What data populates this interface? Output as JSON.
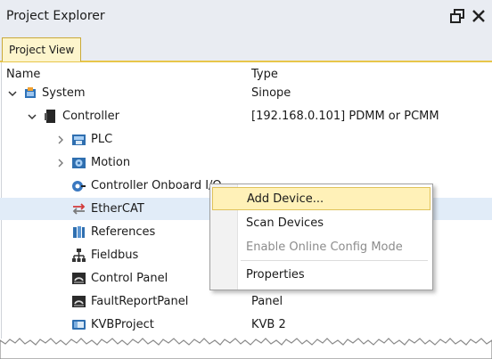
{
  "window": {
    "title": "Project Explorer"
  },
  "tabs": [
    {
      "label": "Project View"
    }
  ],
  "columns": {
    "name": "Name",
    "type": "Type"
  },
  "tree": [
    {
      "label": "System",
      "type": "Sinope"
    },
    {
      "label": "Controller",
      "type": "[192.168.0.101] PDMM or PCMM"
    },
    {
      "label": "PLC",
      "type": ""
    },
    {
      "label": "Motion",
      "type": ""
    },
    {
      "label": "Controller Onboard I/O",
      "type": ""
    },
    {
      "label": "EtherCAT",
      "type": ""
    },
    {
      "label": "References",
      "type": ""
    },
    {
      "label": "Fieldbus",
      "type": ""
    },
    {
      "label": "Control Panel",
      "type": ""
    },
    {
      "label": "FaultReportPanel",
      "type": "Panel"
    },
    {
      "label": "KVBProject",
      "type": "KVB 2"
    }
  ],
  "context_menu": {
    "items": [
      {
        "label": "Add Device...",
        "state": "highlighted"
      },
      {
        "label": "Scan Devices",
        "state": "enabled"
      },
      {
        "label": "Enable Online Config Mode",
        "state": "disabled"
      },
      {
        "label": "Properties",
        "state": "enabled"
      }
    ]
  },
  "colors": {
    "accent": "#e8c64a",
    "selection": "#e1ecf8",
    "menu_highlight": "#fff1b8"
  }
}
